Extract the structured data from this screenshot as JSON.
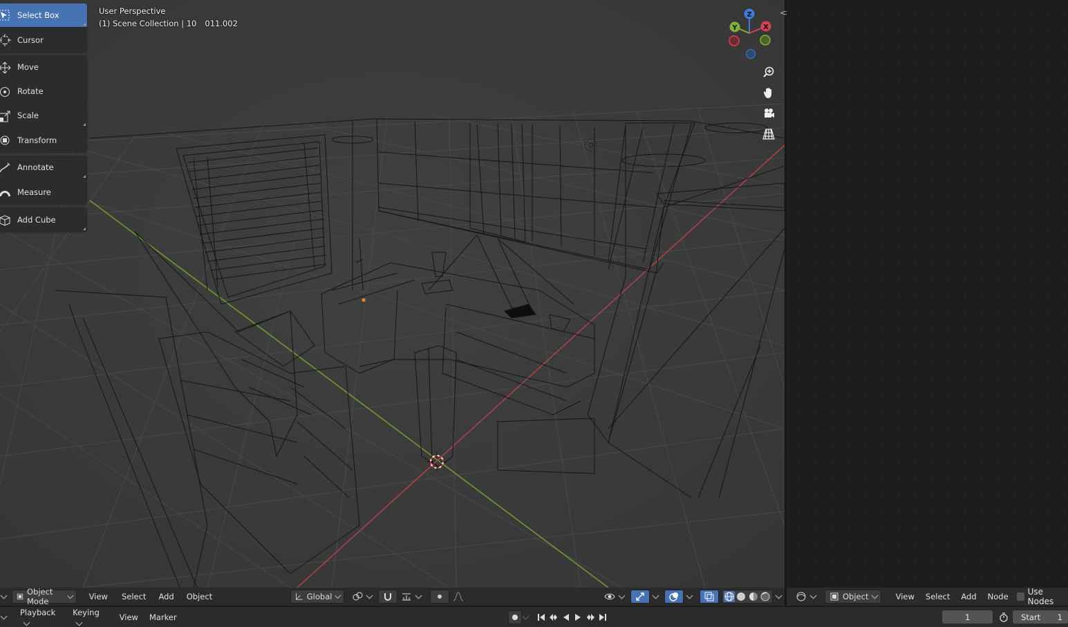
{
  "viewport": {
    "perspective": "User Perspective",
    "collection": "(1) Scene Collection | 10",
    "active_object": "011.002"
  },
  "toolbar": {
    "groups": [
      [
        {
          "label": "Select Box",
          "icon": "select-box-icon",
          "active": true
        },
        {
          "label": "Cursor",
          "icon": "cursor-icon"
        }
      ],
      [
        {
          "label": "Move",
          "icon": "move-icon"
        },
        {
          "label": "Rotate",
          "icon": "rotate-icon"
        },
        {
          "label": "Scale",
          "icon": "scale-icon"
        },
        {
          "label": "Transform",
          "icon": "transform-icon"
        }
      ],
      [
        {
          "label": "Annotate",
          "icon": "annotate-icon"
        },
        {
          "label": "Measure",
          "icon": "measure-icon"
        }
      ],
      [
        {
          "label": "Add Cube",
          "icon": "add-cube-icon"
        }
      ]
    ]
  },
  "gizmo": {
    "z": "Z",
    "y": "Y",
    "x": "X"
  },
  "vp_header": {
    "mode": "Object Mode",
    "menus": [
      "View",
      "Select",
      "Add",
      "Object"
    ],
    "orientation": "Global"
  },
  "node_header": {
    "type": "Object",
    "menus": [
      "View",
      "Select",
      "Add",
      "Node"
    ],
    "use_nodes": "Use Nodes"
  },
  "timeline": {
    "menus": [
      "Playback",
      "Keying",
      "View",
      "Marker"
    ],
    "current_frame": "1",
    "start_label": "Start",
    "start_value": "1"
  },
  "colors": {
    "accent": "#4772b3",
    "axis_x": "#d64350",
    "axis_y": "#80b23a",
    "axis_z": "#3b7dd8"
  }
}
